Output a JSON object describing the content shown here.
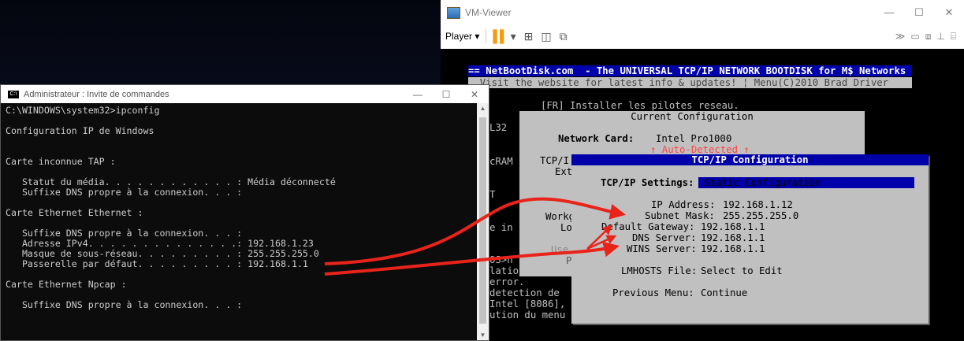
{
  "vm": {
    "title": "VM-Viewer",
    "player_label": "Player ▾",
    "dos": {
      "banner1": "== NetBootDisk.com  - The UNIVERSAL TCP/IP NETWORK BOOTDISK for M$ Networks",
      "banner2": "  Visit the website for latest info & updates! ¦ Menu(C)2010 Brad Driver",
      "install_line": "[FR] Installer les pilotes reseau.",
      "left_fragments": [
        "L32",
        "cRAM",
        "T",
        "e in",
        "OS>n",
        "latio",
        "error.",
        "detection de",
        "Intel [8086],",
        "ution du menu"
      ],
      "current_config": {
        "title": "Current Configuration",
        "network_card_label": "Network Card:",
        "network_card_value": "Intel Pro1000",
        "auto_detected": "↑ Auto-Detected ↑",
        "tcp_frag": "TCP/I",
        "ext_frag": "Ext",
        "workgr_frag": "Workgr",
        "lo_frag": "Lo",
        "use_frag": "Use",
        "p_frag": "P"
      },
      "tcpip": {
        "title": "TCP/IP Configuration",
        "settings_label": "TCP/IP Settings:",
        "settings_value": " Static Configuration           ",
        "ip_label": "IP Address:",
        "ip_value": "192.168.1.12",
        "mask_label": "Subnet Mask:",
        "mask_value": "255.255.255.0",
        "gateway_label": "Default Gateway:",
        "gateway_value": "192.168.1.1",
        "dns_label": "DNS Server:",
        "dns_value": "192.168.1.1",
        "wins_label": "WINS Server:",
        "wins_value": "192.168.1.1",
        "lmhosts_label": "LMHOSTS File:",
        "lmhosts_value": "Select to Edit",
        "prev_label": "Previous Menu:",
        "prev_value": "Continue"
      }
    }
  },
  "cmd": {
    "title": "Administrateur : Invite de commandes",
    "lines": [
      "C:\\WINDOWS\\system32>ipconfig",
      "",
      "Configuration IP de Windows",
      "",
      "",
      "Carte inconnue TAP :",
      "",
      "   Statut du média. . . . . . . . . . . . : Média déconnecté",
      "   Suffixe DNS propre à la connexion. . . :",
      "",
      "Carte Ethernet Ethernet :",
      "",
      "   Suffixe DNS propre à la connexion. . . :",
      "   Adresse IPv4. . . . . . . . . . . . . .: 192.168.1.23",
      "   Masque de sous-réseau. . . . . . . . . : 255.255.255.0",
      "   Passerelle par défaut. . . . . . . . . : 192.168.1.1",
      "",
      "Carte Ethernet Npcap :",
      "",
      "   Suffixe DNS propre à la connexion. . . :"
    ]
  },
  "colors": {
    "arrow": "#e8231a",
    "dos_blue": "#0000aa",
    "dos_gray": "#c0c0c0"
  }
}
